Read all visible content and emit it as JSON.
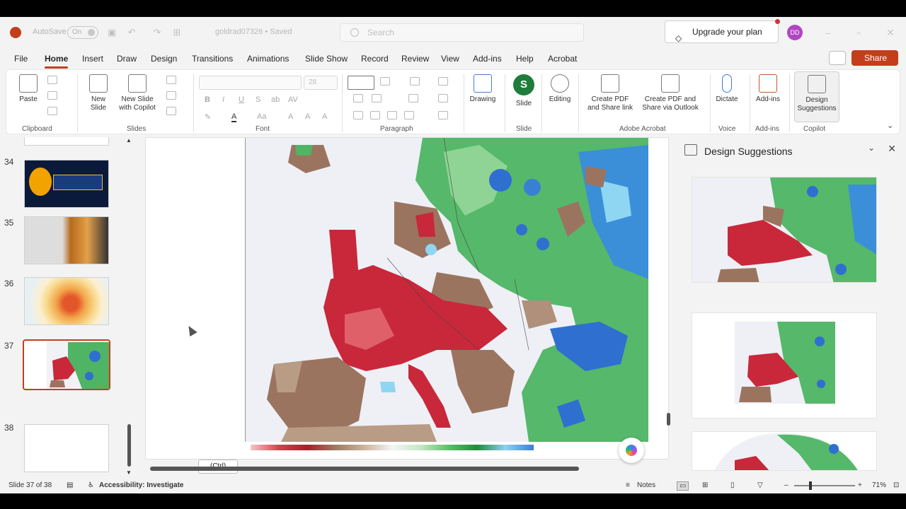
{
  "titlebar": {
    "autosave_label": "AutoSave",
    "autosave_state": "On",
    "filename": "goldrad07326 • Saved",
    "search_placeholder": "Search",
    "upgrade_label": "Upgrade your plan",
    "avatar_initials": "DD"
  },
  "menu": {
    "items": [
      "File",
      "Home",
      "Insert",
      "Draw",
      "Design",
      "Transitions",
      "Animations",
      "Slide Show",
      "Record",
      "Review",
      "View",
      "Add-ins",
      "Help",
      "Acrobat"
    ],
    "active": "Home",
    "share_label": "Share"
  },
  "ribbon": {
    "groups": {
      "clipboard": "Clipboard",
      "slides": "Slides",
      "font": "Font",
      "paragraph": "Paragraph",
      "adobe": "Adobe Acrobat",
      "voice": "Voice",
      "addins": "Add-ins",
      "copilot": "Copilot",
      "slide": "Slide"
    },
    "buttons": {
      "paste": "Paste",
      "new_slide_1": "New",
      "new_slide_2": "Slide",
      "new_copilot_1": "New Slide",
      "new_copilot_2": "with Copilot",
      "font_size": "28",
      "drawing": "Drawing",
      "slide": "Slide",
      "editing": "Editing",
      "create_pdf_1": "Create PDF",
      "create_pdf_2": "and Share link",
      "create_pdf_outlook_1": "Create PDF and",
      "create_pdf_outlook_2": "Share via Outlook",
      "dictate": "Dictate",
      "addins": "Add-ins",
      "design_1": "Design",
      "design_2": "Suggestions"
    }
  },
  "thumbnails": {
    "numbers": [
      "34",
      "35",
      "36",
      "37",
      "38"
    ],
    "selected": "37"
  },
  "canvas": {
    "paste_options": "(Ctrl)"
  },
  "design_pane": {
    "title": "Design Suggestions"
  },
  "status": {
    "slide_info": "Slide 37 of 38",
    "accessibility": "Accessibility: Investigate",
    "notes": "Notes",
    "zoom": "71%"
  },
  "colors": {
    "accent": "#c43e1c",
    "dry_red": "#c8283a",
    "dry_brown": "#9b7460",
    "wet_green": "#3aa856",
    "wet_blue": "#2f6fd0"
  }
}
